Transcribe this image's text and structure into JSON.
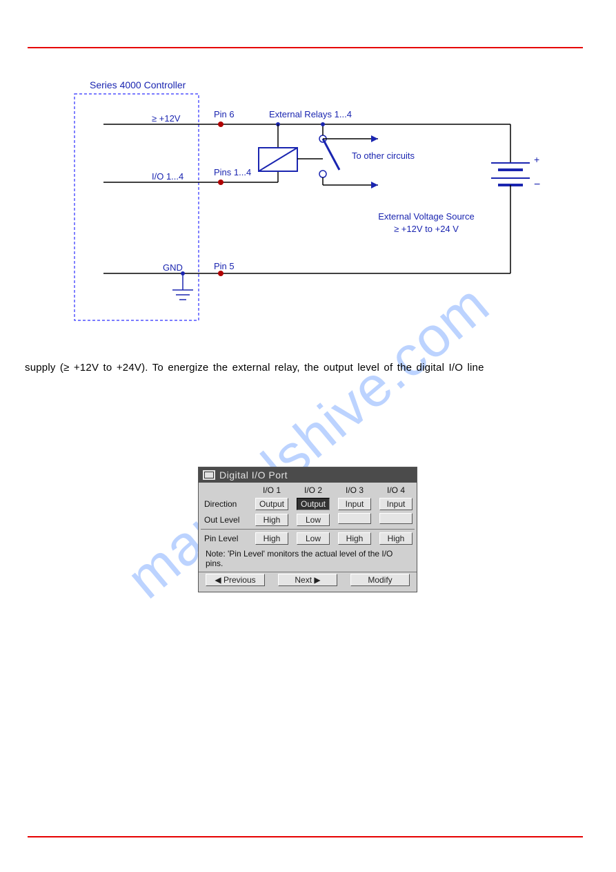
{
  "diagram": {
    "box_label": "Series 4000 Controller",
    "line1_left": "≥ +12V",
    "line1_pin": "Pin 6",
    "line2_left": "I/O 1...4",
    "line2_pin": "Pins 1...4",
    "gnd_label": "GND",
    "gnd_pin": "Pin 5",
    "relays_label": "External Relays 1...4",
    "other_circuits": "To other circuits",
    "src_line1": "External Voltage Source",
    "src_line2": "≥ +12V to +24 V",
    "battery_plus": "+",
    "battery_minus": "−"
  },
  "body_text": "supply (≥ +12V to +24V). To energize the external relay, the output level of the digital I/O line",
  "panel": {
    "title": "Digital I/O Port",
    "columns": [
      "I/O 1",
      "I/O 2",
      "I/O 3",
      "I/O 4"
    ],
    "rows": {
      "direction": {
        "label": "Direction",
        "values": [
          "Output",
          "Output",
          "Input",
          "Input"
        ],
        "selected_index": 1
      },
      "out_level": {
        "label": "Out Level",
        "values": [
          "High",
          "Low",
          "",
          ""
        ]
      },
      "pin_level": {
        "label": "Pin Level",
        "values": [
          "High",
          "Low",
          "High",
          "High"
        ]
      }
    },
    "note": "Note: 'Pin Level' monitors the actual level of the I/O pins.",
    "buttons": {
      "prev": "◀ Previous",
      "next": "Next ▶",
      "modify": "Modify"
    }
  },
  "watermark": "manualshive.com"
}
